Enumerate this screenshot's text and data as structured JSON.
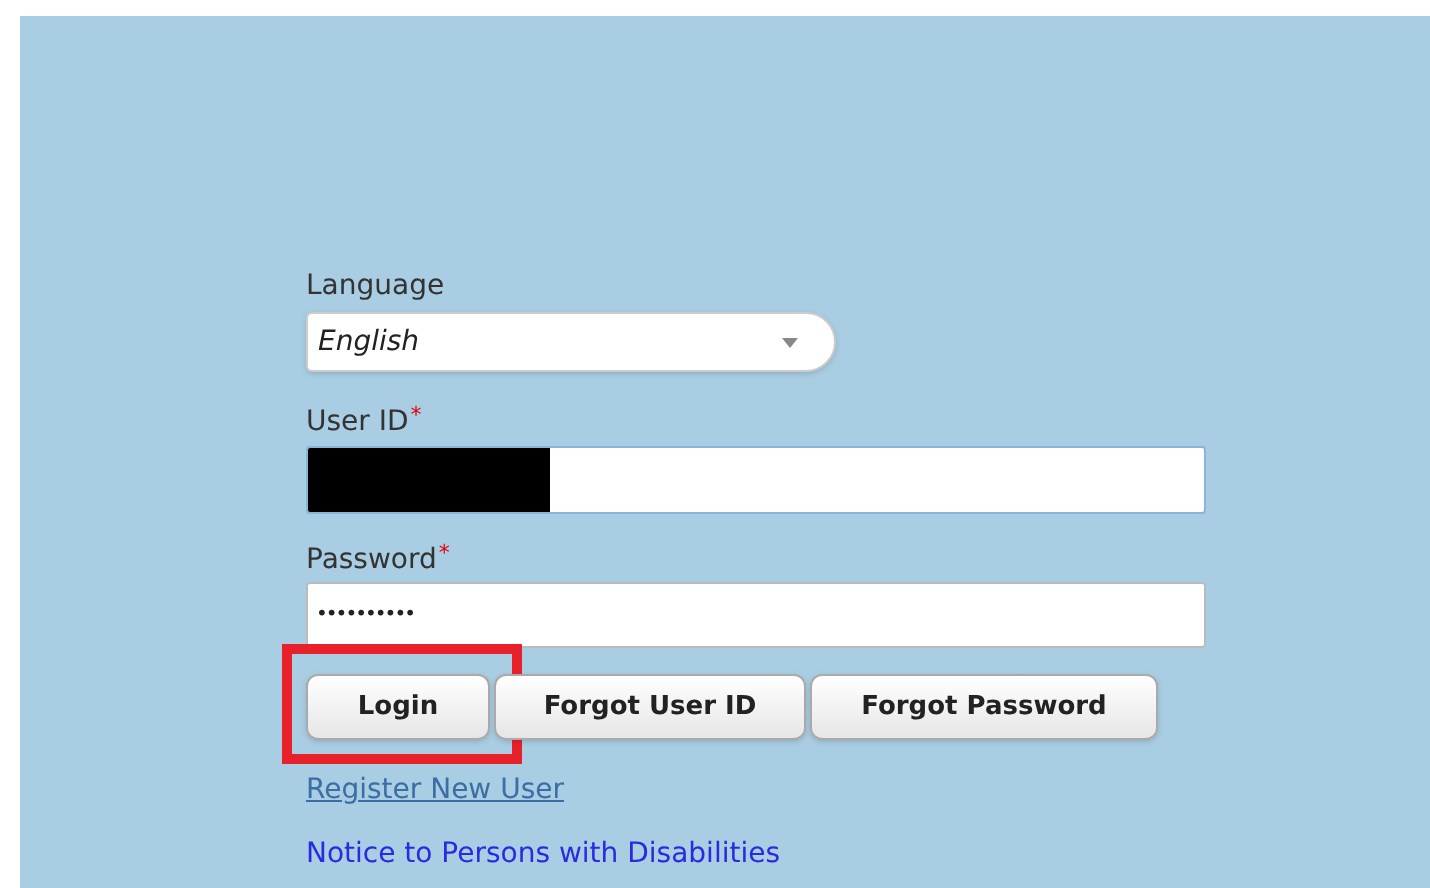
{
  "language": {
    "label": "Language",
    "value": "English"
  },
  "user_id": {
    "label": "User ID",
    "required_mark": "*",
    "redacted": true
  },
  "password": {
    "label": "Password",
    "required_mark": "*",
    "value": "••••••••••"
  },
  "buttons": [
    {
      "label": "Login",
      "highlighted": true
    },
    {
      "label": "Forgot User ID",
      "highlighted": false
    },
    {
      "label": "Forgot Password",
      "highlighted": false
    }
  ],
  "links": [
    {
      "label": "Register New User",
      "kind": "underlined"
    },
    {
      "label": "Notice to Persons with Disabilities",
      "kind": "plain"
    }
  ]
}
